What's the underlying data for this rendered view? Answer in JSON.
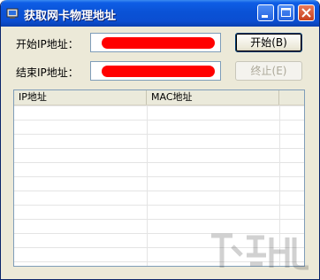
{
  "window": {
    "title": "获取网卡物理地址"
  },
  "form": {
    "start_ip_label": "开始IP地址：",
    "end_ip_label": "结束IP地址：",
    "start_ip_value": "",
    "end_ip_value": ""
  },
  "buttons": {
    "start_label": "开始(B)",
    "stop_label": "终止(E)"
  },
  "list": {
    "columns": [
      "IP地址",
      "MAC地址",
      ""
    ],
    "rows": []
  },
  "colors": {
    "titlebar": "#0a52d6",
    "redaction": "#ff0000",
    "dialog_bg": "#ece9d8"
  }
}
